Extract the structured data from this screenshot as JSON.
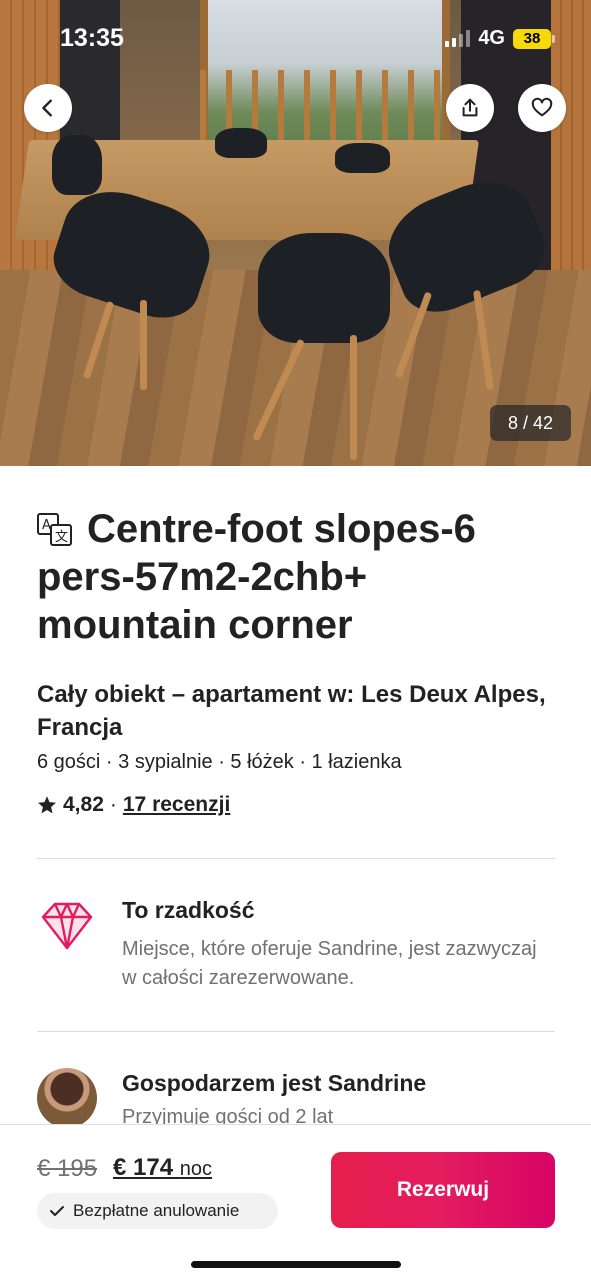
{
  "status_bar": {
    "time": "13:35",
    "network": "4G",
    "battery": "38"
  },
  "gallery": {
    "counter": "8 / 42"
  },
  "listing": {
    "title": "Centre-foot slopes-6 pers-57m2-2chb+ mountain corner",
    "subtitle": "Cały obiekt – apartament w: Les Deux Alpes, Francja",
    "details": "6 gości · 3 sypialnie · 5 łóżek · 1 łazienka",
    "rating_value": "4,82",
    "rating_sep": "·",
    "reviews_link": "17 recenzji"
  },
  "highlight": {
    "title": "To rzadkość",
    "text": "Miejsce, które oferuje Sandrine, jest zazwyczaj w całości zarezerwowane."
  },
  "host": {
    "title": "Gospodarzem jest Sandrine",
    "subtitle": "Przyjmuje gości od 2 lat"
  },
  "booking": {
    "old_price": "€ 195",
    "new_price": "€ 174",
    "price_unit": "noc",
    "free_cancel": "Bezpłatne anulowanie",
    "reserve_label": "Rezerwuj"
  },
  "colors": {
    "accent": "#e31c5f",
    "gem": "#e31c5f"
  },
  "icons": [
    "back-arrow-icon",
    "share-icon",
    "heart-icon",
    "translate-icon",
    "star-icon",
    "diamond-icon",
    "check-icon"
  ]
}
